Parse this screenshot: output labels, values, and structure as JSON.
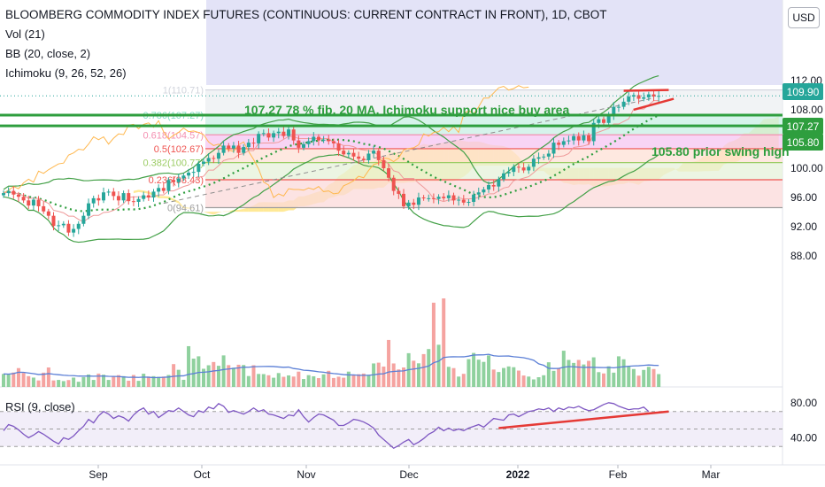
{
  "header": {
    "title": "BLOOMBERG COMMODITY INDEX FUTURES (CONTINUOUS: CURRENT CONTRACT IN FRONT), 1D, CBOT",
    "vol_label": "Vol (21)",
    "bb_label": "BB (20, close, 2)",
    "ichimoku_label": "Ichimoku (9, 26, 52, 26)",
    "currency": "USD"
  },
  "annotations": {
    "buy_area": "107.27 78 % fib, 20 MA, Ichimoku support nice buy area",
    "swing_high": "105.80 prior swing high"
  },
  "price_tags": {
    "last": "109.90",
    "support_1": "107.27",
    "support_2": "105.80"
  },
  "colors": {
    "up": "#26a69a",
    "down": "#ef5350",
    "annotation_green": "#2e9e3e",
    "bollinger": "#43a047",
    "ichimoku_cloud": "#ffe066",
    "rsi_line": "#7e57c2",
    "last_price": "#26a69a"
  },
  "chart_data": [
    {
      "type": "candlestick",
      "title": "BLOOMBERG COMMODITY INDEX FUTURES (CONTINUOUS: CURRENT CONTRACT IN FRONT), 1D, CBOT",
      "x_ticks": [
        "Sep",
        "Oct",
        "Nov",
        "Dec",
        "2022",
        "Feb",
        "Mar"
      ],
      "y_ticks": [
        "112.00",
        "108.00",
        "104.00",
        "100.00",
        "96.00",
        "92.00",
        "88.00"
      ],
      "ylim": [
        84.5,
        115.5
      ],
      "last_value": 109.9,
      "horizontal_levels": [
        107.27,
        105.8
      ],
      "fibonacci_levels": [
        {
          "label": "1(110.71)",
          "value": 110.71
        },
        {
          "label": "0.786(107.27)",
          "value": 107.27
        },
        {
          "label": "0.618(104.57)",
          "value": 104.57
        },
        {
          "label": "0.5(102.67)",
          "value": 102.67
        },
        {
          "label": "0.382(100.77)",
          "value": 100.77
        },
        {
          "label": "0.236(98.43)",
          "value": 98.43
        },
        {
          "label": "0(94.61)",
          "value": 94.61
        }
      ],
      "closes": [
        96.6,
        96.9,
        96.4,
        96.1,
        95.6,
        94.9,
        95.7,
        94.8,
        94.1,
        93.5,
        92.1,
        92.2,
        92.4,
        91.2,
        91.7,
        92.4,
        93.5,
        95.2,
        95.9,
        95.6,
        96.7,
        96.8,
        96.2,
        95.6,
        96.6,
        95.5,
        95.4,
        95.8,
        96.3,
        96.0,
        96.8,
        97.3,
        96.9,
        98.4,
        98.1,
        98.6,
        99.0,
        99.4,
        99.5,
        100.6,
        100.9,
        101.4,
        101.3,
        102.1,
        103.1,
        102.7,
        103.1,
        102.1,
        102.9,
        103.5,
        103.4,
        104.7,
        104.8,
        104.2,
        104.8,
        105.0,
        104.4,
        105.3,
        103.8,
        102.8,
        103.3,
        103.7,
        104.3,
        103.8,
        103.9,
        103.7,
        103.4,
        102.4,
        101.9,
        102.1,
        101.6,
        101.3,
        101.1,
        102.0,
        102.4,
        101.1,
        100.0,
        98.7,
        96.9,
        96.5,
        94.8,
        95.3,
        95.0,
        96.0,
        95.9,
        95.9,
        95.8,
        96.1,
        95.9,
        96.3,
        95.6,
        95.7,
        95.3,
        95.4,
        96.4,
        96.7,
        97.1,
        97.7,
        97.5,
        98.5,
        99.3,
        99.5,
        100.2,
        100.1,
        99.7,
        100.2,
        101.3,
        101.5,
        101.6,
        102.0,
        103.5,
        103.2,
        103.7,
        103.8,
        104.4,
        103.8,
        104.5,
        103.7,
        106.2,
        106.7,
        106.2,
        107.2,
        108.4,
        108.4,
        109.1,
        109.8,
        110.0,
        109.5,
        109.7,
        110.1,
        109.8,
        109.9
      ],
      "volume": [
        1.0,
        0.98,
        1.11,
        1.45,
        1.08,
        0.83,
        0.72,
        0.5,
        1.1,
        1.5,
        0.5,
        0.54,
        0.45,
        0.53,
        0.72,
        0.4,
        0.76,
        0.96,
        0.54,
        1.03,
        0.94,
        0.54,
        0.82,
        0.91,
        0.83,
        0.48,
        0.92,
        0.47,
        1.02,
        0.8,
        0.83,
        0.78,
        0.8,
        0.92,
        1.76,
        1.32,
        0.55,
        3.14,
        2.18,
        2.36,
        1.4,
        1.67,
        1.92,
        1.63,
        2.43,
        1.68,
        1.48,
        1.71,
        1.69,
        0.84,
        1.67,
        1.0,
        0.99,
        0.9,
        0.71,
        1.07,
        0.78,
        0.89,
        0.8,
        1.18,
        0.61,
        0.91,
        0.82,
        0.68,
        0.97,
        1.24,
        0.69,
        0.79,
        0.71,
        1.18,
        0.89,
        0.98,
        1.03,
        0.93,
        1.81,
        1.87,
        1.57,
        3.62,
        1.81,
        1.35,
        1.5,
        2.6,
        2.02,
        1.82,
        2.53,
        2.92,
        6.49,
        3.25,
        6.82,
        1.55,
        1.45,
        0.8,
        1.01,
        2.14,
        2.62,
        2.1,
        1.93,
        2.43,
        1.34,
        1.15,
        1.46,
        1.58,
        1.52,
        1.26,
        0.88,
        0.8,
        0.58,
        0.75,
        0.9,
        1.9,
        1.24,
        1.47,
        2.79,
        2.08,
        1.85,
        2.08,
        1.73,
        2.01,
        2.28,
        1.14,
        1.04,
        1.59,
        1.1,
        2.36,
        2.13,
        1.61,
        1.38,
        0.87,
        1.31,
        1.55,
        1.38,
        0.99
      ],
      "rsi": [
        48,
        55,
        53,
        49,
        44,
        40,
        43,
        47,
        44,
        40,
        36,
        33,
        40,
        38,
        42,
        48,
        53,
        61,
        57,
        65,
        70,
        67,
        62,
        65,
        63,
        59,
        66,
        71,
        74,
        67,
        70,
        63,
        67,
        71,
        70,
        74,
        70,
        66,
        64,
        71,
        69,
        75,
        73,
        79,
        76,
        69,
        71,
        69,
        67,
        70,
        74,
        70,
        72,
        67,
        66,
        64,
        62,
        66,
        65,
        72,
        64,
        58,
        63,
        67,
        66,
        63,
        60,
        54,
        54,
        57,
        61,
        60,
        58,
        55,
        51,
        43,
        38,
        33,
        28,
        31,
        35,
        38,
        32,
        35,
        39,
        44,
        47,
        52,
        48,
        51,
        48,
        50,
        48,
        51,
        53,
        55,
        52,
        57,
        62,
        61,
        60,
        66,
        67,
        64,
        67,
        70,
        71,
        73,
        72,
        74,
        70,
        74,
        72,
        75,
        74,
        76,
        73,
        71,
        72,
        75,
        78,
        80,
        79,
        76,
        74,
        72,
        73,
        73,
        75,
        70
      ],
      "rsi_label": "RSI (9, close)",
      "rsi_ticks": [
        "80.00",
        "40.00"
      ],
      "rsi_ylim": [
        12,
        95
      ]
    }
  ]
}
